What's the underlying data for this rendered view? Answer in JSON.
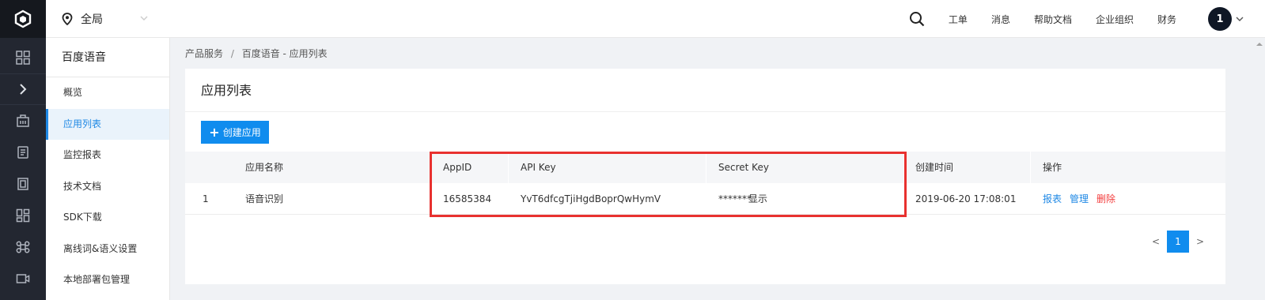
{
  "header": {
    "region": "全局",
    "nav": [
      "工单",
      "消息",
      "帮助文档",
      "企业组织",
      "财务"
    ],
    "avatar": "1"
  },
  "sidebar": {
    "title": "百度语音",
    "items": [
      {
        "label": "概览",
        "active": false
      },
      {
        "label": "应用列表",
        "active": true
      },
      {
        "label": "监控报表",
        "active": false
      },
      {
        "label": "技术文档",
        "active": false
      },
      {
        "label": "SDK下载",
        "active": false
      },
      {
        "label": "离线词&语义设置",
        "active": false
      },
      {
        "label": "本地部署包管理",
        "active": false
      }
    ]
  },
  "breadcrumb": {
    "parent": "产品服务",
    "separator": "/",
    "current": "百度语音 - 应用列表"
  },
  "main": {
    "title": "应用列表",
    "create_label": "创建应用",
    "table": {
      "columns": [
        "应用名称",
        "AppID",
        "API Key",
        "Secret Key",
        "创建时间",
        "操作"
      ],
      "rows": [
        {
          "index": "1",
          "name": "语音识别",
          "app_id": "16585384",
          "api_key": "YvT6dfcgTjiHgdBoprQwHymV",
          "secret_key_masked": "*******",
          "secret_show": "显示",
          "created": "2019-06-20 17:08:01",
          "ops": [
            "报表",
            "管理",
            "删除"
          ]
        }
      ]
    },
    "pagination": {
      "prev": "<",
      "current": "1",
      "next": ">"
    }
  },
  "colors": {
    "accent": "#108cee",
    "danger": "#f33e3e",
    "highlight": "#e8312f",
    "rail": "#232731"
  }
}
